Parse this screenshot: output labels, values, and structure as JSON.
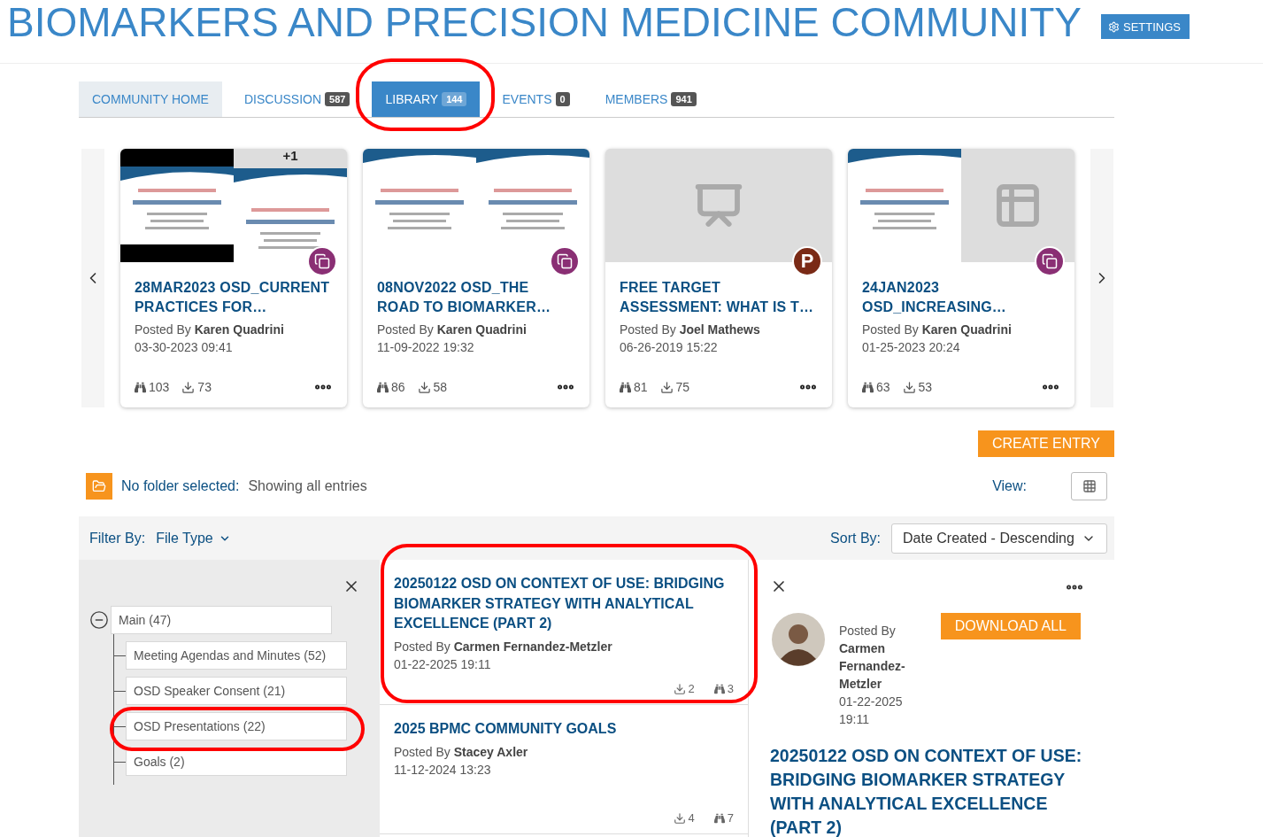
{
  "header": {
    "title": "BIOMARKERS AND PRECISION MEDICINE COMMUNITY",
    "settings": "SETTINGS"
  },
  "tabs": [
    {
      "label": "COMMUNITY HOME",
      "kind": "home",
      "selected": false
    },
    {
      "label": "DISCUSSION",
      "count": "587",
      "kind": "section",
      "selected": false
    },
    {
      "label": "LIBRARY",
      "count": "144",
      "kind": "section",
      "selected": true
    },
    {
      "label": "EVENTS",
      "count": "0",
      "kind": "section",
      "selected": false
    },
    {
      "label": "MEMBERS",
      "count": "941",
      "kind": "section",
      "selected": false
    }
  ],
  "featured": [
    {
      "thumbnail": {
        "kind": "collage",
        "extra": "+1"
      },
      "badge": {
        "kind": "document"
      },
      "title": "28MAR2023 OSD_CURRENT PRACTICES FOR…",
      "posted_by": "Posted By",
      "author": "Karen Quadrini",
      "date": "03-30-2023 09:41",
      "views": "103",
      "downloads": "73"
    },
    {
      "thumbnail": {
        "kind": "slides"
      },
      "badge": {
        "kind": "document"
      },
      "title": "08NOV2022 OSD_THE ROAD TO BIOMARKER…",
      "posted_by": "Posted By",
      "author": "Karen Quadrini",
      "date": "11-09-2022 19:32",
      "views": "86",
      "downloads": "58"
    },
    {
      "thumbnail": {
        "kind": "placeholder"
      },
      "badge": {
        "kind": "powerpoint",
        "text": "P"
      },
      "title": "FREE TARGET ASSESSMENT: WHAT IS T…",
      "posted_by": "Posted By",
      "author": "Joel Mathews",
      "date": "06-26-2019 15:22",
      "views": "81",
      "downloads": "75"
    },
    {
      "thumbnail": {
        "kind": "slide-and-table"
      },
      "badge": {
        "kind": "document"
      },
      "title": "24JAN2023 OSD_INCREASING…",
      "posted_by": "Posted By",
      "author": "Karen Quadrini",
      "date": "01-25-2023 20:24",
      "views": "63",
      "downloads": "53"
    }
  ],
  "create_entry": "CREATE ENTRY",
  "folder_status": {
    "label": "No folder selected:",
    "value": "Showing all entries"
  },
  "view_label": "View:",
  "filter": {
    "label": "Filter By:",
    "value": "File Type"
  },
  "sort": {
    "label": "Sort By:",
    "value": "Date Created - Descending"
  },
  "folders": [
    {
      "label": "Main (47)",
      "expanded": true,
      "children": [
        {
          "label": "Meeting Agendas and Minutes (52)"
        },
        {
          "label": "OSD Speaker Consent (21)"
        },
        {
          "label": "OSD Presentations (22)"
        },
        {
          "label": "Goals (2)"
        }
      ]
    }
  ],
  "entries": [
    {
      "title": "20250122 OSD ON CONTEXT OF USE: BRIDGING BIOMARKER STRATEGY WITH ANALYTICAL EXCELLENCE (PART 2)",
      "posted_by": "Posted By",
      "author": "Carmen Fernandez-Metzler",
      "date": "01-22-2025 19:11",
      "downloads": "2",
      "views": "3"
    },
    {
      "title": "2025 BPMC COMMUNITY GOALS",
      "posted_by": "Posted By",
      "author": "Stacey Axler",
      "date": "11-12-2024 13:23",
      "downloads": "4",
      "views": "7"
    }
  ],
  "detail": {
    "posted_by": "Posted By",
    "author": "Carmen Fernandez-Metzler",
    "date": "01-22-2025 19:11",
    "download_all": "DOWNLOAD ALL",
    "title": "20250122 OSD ON CONTEXT OF USE: BRIDGING BIOMARKER STRATEGY WITH ANALYTICAL EXCELLENCE (PART 2)"
  }
}
